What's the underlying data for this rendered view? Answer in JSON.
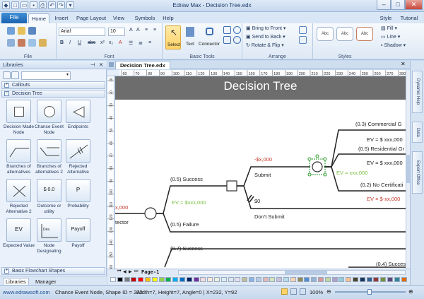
{
  "window": {
    "title": "Edraw Max - Decision Tree.edx",
    "help_icon": "?"
  },
  "tabs": {
    "file": "File",
    "items": [
      "Home",
      "Insert",
      "Page Layout",
      "View",
      "Symbols",
      "Help"
    ],
    "right": {
      "style": "Style",
      "tutorial": "Tutorial"
    }
  },
  "ribbon": {
    "groups": {
      "file": "File",
      "font": "Font",
      "basic_tools": "Basic Tools",
      "arrange": "Arrange",
      "styles": "Styles"
    },
    "font_name": "Arial",
    "font_size": "10",
    "tools": {
      "select": "Select",
      "text": "Text",
      "connector": "Connector"
    },
    "arrange": {
      "bring_front": "Bring to Front",
      "send_back": "Send to Back",
      "rotate_flip": "Rotate & Flip"
    },
    "styles": {
      "sample": "Abc",
      "fill": "Fill",
      "line": "Line",
      "shadow": "Shadow"
    }
  },
  "libraries": {
    "title": "Libraries",
    "categories": {
      "callouts": "Callouts",
      "decision_tree": "Decision Tree",
      "basic_flowchart": "Basic Flowchart Shapes"
    },
    "shapes": [
      {
        "label": "Decision Made Node"
      },
      {
        "label": "Chance Event Node"
      },
      {
        "label": "Endpoints"
      },
      {
        "label": "Branches of alternatives"
      },
      {
        "label": "Branches of alternatives 2"
      },
      {
        "label": "Rejected Alternative"
      },
      {
        "label": "Rejected Alternative 2"
      },
      {
        "label": "Outcome or utility",
        "glyph": "$ 0.0"
      },
      {
        "label": "Probability",
        "glyph": "P"
      },
      {
        "label": "Expected Value",
        "glyph": "EV"
      },
      {
        "label": "Node Designating",
        "glyph": "Des."
      },
      {
        "label": "Payoff",
        "glyph": "Payoff"
      }
    ],
    "bottom_tabs": {
      "libraries": "Libraries",
      "manager": "Manager"
    }
  },
  "document": {
    "tab": "Decision Tree.edx",
    "page_tab": "Page-1"
  },
  "ruler": {
    "top": [
      "60",
      "70",
      "80",
      "90",
      "100",
      "110",
      "120",
      "130",
      "140",
      "150",
      "160",
      "170",
      "180",
      "190",
      "200",
      "210",
      "220",
      "230",
      "240",
      "250",
      "260",
      "270",
      "280"
    ],
    "left": [
      "10",
      "20",
      "30",
      "40",
      "50",
      "60",
      "70",
      "80",
      "90",
      "100",
      "110",
      "120",
      "130",
      "140",
      "150",
      "160"
    ]
  },
  "diagram": {
    "title": "Decision Tree",
    "labels": {
      "commercial": "(0.3) Commercial G",
      "ev1": "EV = $ xxx,000",
      "residential": "(0.5) Residential Gr",
      "cost": "-$x,000",
      "submit": "Submit",
      "ev2": "EV = $ xxx,000",
      "ev_green": "EV = xxx,000",
      "no_cert": "(0.2) No Certificati",
      "success": "(0.5) Success",
      "ev_neg": "EV = $-xx,000",
      "left_cost": "x,000",
      "ev_green2": "EV = $xxx,000",
      "zero": "$0",
      "left_text": "tector",
      "failure": "(0.5) Failure",
      "dont_submit": "Don't Submit",
      "success2": "(0.7) Success",
      "success3": "(0.4) Succes"
    }
  },
  "right_panels": [
    "Dynamic Help",
    "Data",
    "Export Office"
  ],
  "status": {
    "link": "www.edrawsoft.com",
    "info": "Chance Event Node, Shape ID = 272",
    "dims": "Width=7, Height=7, Angle=0 | X=232, Y=92",
    "zoom": "100%"
  },
  "palette": [
    "#ffffff",
    "#000000",
    "#7f7f7f",
    "#c00000",
    "#ff0000",
    "#ffc000",
    "#ffff00",
    "#92d050",
    "#00b050",
    "#00b0f0",
    "#0070c0",
    "#002060",
    "#7030a0",
    "#f2dcdb",
    "#fde9d9",
    "#ebf1de",
    "#dbeef3",
    "#dce6f2",
    "#e5e0ec",
    "#c4bd97",
    "#8db3e2",
    "#b8cce4",
    "#e5b9b7",
    "#d7e4bc",
    "#ccc1d9",
    "#b7dde8",
    "#fbd4b4",
    "#938953",
    "#548dd4",
    "#95b3d7",
    "#d99694",
    "#c3d69b",
    "#b2a2c7",
    "#92cddc",
    "#fac08f",
    "#4a442a",
    "#17365d",
    "#366092",
    "#953734",
    "#76923c",
    "#5f497a",
    "#31859b",
    "#e36c09"
  ]
}
